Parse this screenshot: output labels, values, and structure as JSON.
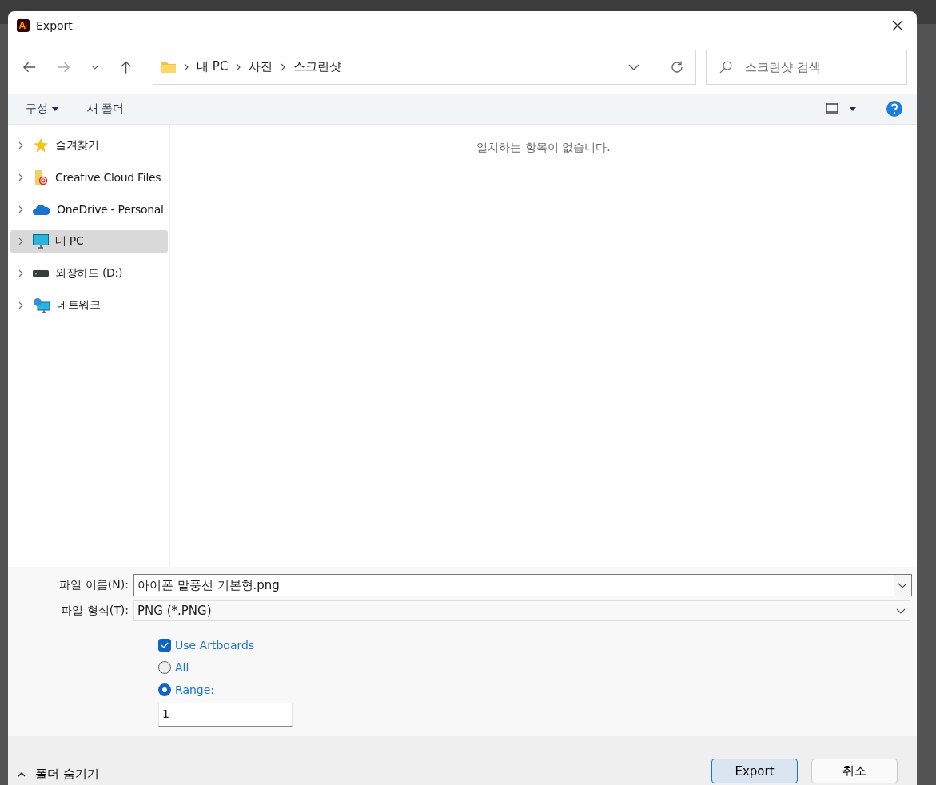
{
  "window": {
    "title": "Export"
  },
  "breadcrumb": [
    "내 PC",
    "사진",
    "스크린샷"
  ],
  "search": {
    "placeholder": "스크린샷 검색"
  },
  "commands": [
    {
      "label": "구성",
      "dropdown": true
    },
    {
      "label": "새 폴더",
      "dropdown": false
    }
  ],
  "sidebar": {
    "items": [
      {
        "label": "즐겨찾기",
        "kind": "favorites",
        "selected": false
      },
      {
        "label": "Creative Cloud Files",
        "kind": "cloud-folder",
        "selected": false
      },
      {
        "label": "OneDrive - Personal",
        "kind": "cloud",
        "selected": false
      },
      {
        "label": "내 PC",
        "kind": "computer",
        "selected": true
      },
      {
        "label": "외장하드 (D:)",
        "kind": "drive",
        "selected": false
      },
      {
        "label": "네트워크",
        "kind": "network",
        "selected": false
      }
    ]
  },
  "empty_message": "일치하는 항목이 없습니다.",
  "file_name": {
    "label": "파일 이름(N):",
    "value": "아이폰 말풍선 기본형.png"
  },
  "file_type": {
    "label": "파일 형식(T):",
    "value": "PNG (*.PNG)"
  },
  "options": [
    {
      "kind": "checkbox",
      "label": "Use Artboards",
      "checked": true
    },
    {
      "kind": "radio",
      "label": "All",
      "selected": false
    },
    {
      "kind": "radio",
      "label": "Range:",
      "selected": true
    }
  ],
  "range_value": "1",
  "hide_folders": "폴더 숨기기",
  "buttons": [
    {
      "label": "Export",
      "default": true
    },
    {
      "label": "취소",
      "default": false
    }
  ]
}
